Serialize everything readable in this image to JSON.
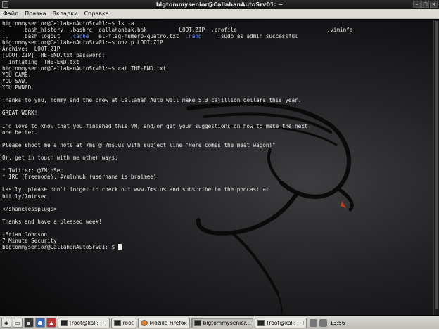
{
  "window": {
    "title": "bigtommysenior@CallahanAutoSrv01: ~",
    "controls": [
      "–",
      "□",
      "×"
    ]
  },
  "menu": [
    "Файл",
    "Правка",
    "Вкладки",
    "Справка"
  ],
  "terminal": {
    "lines": [
      [
        {
          "t": "bigtommysenior@CallahanAutoSrv01:~$ ls -a"
        }
      ],
      [
        {
          "t": ".     .bash_history  .bashrc  callahanbak.bak          LOOT.ZIP  .profile                            .viminfo"
        }
      ],
      [
        {
          "t": "..    .bash_logout   "
        },
        {
          "t": ".cache",
          "c": "blue"
        },
        {
          "t": "   el-flag-numero-quatro.txt  "
        },
        {
          "t": ".nano",
          "c": "blue"
        },
        {
          "t": "     .sudo_as_admin_successful"
        }
      ],
      [
        {
          "t": "bigtommysenior@CallahanAutoSrv01:~$ unzip LOOT.ZIP"
        }
      ],
      [
        {
          "t": "Archive:  LOOT.ZIP"
        }
      ],
      [
        {
          "t": "[LOOT.ZIP] THE-END.txt password:"
        }
      ],
      [
        {
          "t": "  inflating: THE-END.txt"
        }
      ],
      [
        {
          "t": "bigtommysenior@CallahanAutoSrv01:~$ cat THE-END.txt"
        }
      ],
      [
        {
          "t": "YOU CAME."
        }
      ],
      [
        {
          "t": "YOU SAW."
        }
      ],
      [
        {
          "t": "YOU PWNED."
        }
      ],
      [],
      [
        {
          "t": "Thanks to you, Tommy and the crew at Callahan Auto will make 5.3 cajillion dollars this year."
        }
      ],
      [],
      [
        {
          "t": "GREAT WORK!"
        }
      ],
      [],
      [
        {
          "t": "I'd love to know that you finished this VM, and/or get your suggestions on how to make the next"
        }
      ],
      [
        {
          "t": "one better."
        }
      ],
      [],
      [
        {
          "t": "Please shoot me a note at 7ms @ 7ms.us with subject line \"Here comes the meat wagon!\""
        }
      ],
      [],
      [
        {
          "t": "Or, get in touch with me other ways:"
        }
      ],
      [],
      [
        {
          "t": "* Twitter: @7MinSec"
        }
      ],
      [
        {
          "t": "* IRC (Freenode): #vulnhub (username is braimee)"
        }
      ],
      [],
      [
        {
          "t": "Lastly, please don't forget to check out www.7ms.us and subscribe to the podcast at"
        }
      ],
      [
        {
          "t": "bit.ly/7minsec"
        }
      ],
      [],
      [
        {
          "t": "</shamelessplugs>"
        }
      ],
      [],
      [
        {
          "t": "Thanks and have a blessed week!"
        }
      ],
      [],
      [
        {
          "t": "-Brian Johnson"
        }
      ],
      [
        {
          "t": "7 Minute Security"
        }
      ],
      [
        {
          "t": "bigtommysenior@CallahanAutoSrv01:~$ "
        }
      ]
    ]
  },
  "taskbar": {
    "tasks": [
      {
        "label": "[root@kali: ~]",
        "icon": "terminal-icon"
      },
      {
        "label": "root",
        "icon": "terminal-icon"
      },
      {
        "label": "Mozilla Firefox",
        "icon": "firefox-icon"
      },
      {
        "label": "bigtommysenior...",
        "icon": "terminal-icon",
        "active": true
      },
      {
        "label": "[root@kali: ~]",
        "icon": "terminal-icon"
      }
    ],
    "clock": "13:56"
  }
}
